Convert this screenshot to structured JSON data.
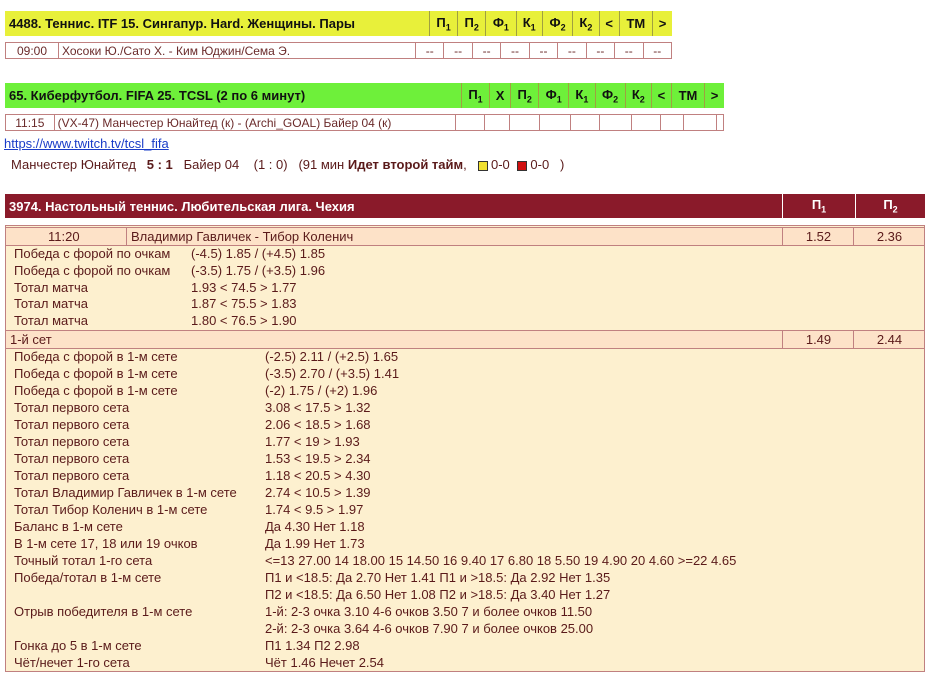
{
  "tennis": {
    "header_title": "4488. Теннис. ITF 15. Сингапур. Hard. Женщины. Пары",
    "cols": [
      "П1",
      "П2",
      "Ф1",
      "К1",
      "Ф2",
      "К2",
      "<",
      "ТМ",
      ">"
    ],
    "match": {
      "time": "09:00",
      "teams": "Хосоки Ю./Сато Х. - Ким Юджин/Сема Э.",
      "cells": [
        "--",
        "--",
        "--",
        "--",
        "--",
        "--",
        "--",
        "--",
        "--"
      ]
    }
  },
  "cyber": {
    "header_title": "65. Киберфутбол. FIFA 25. TCSL (2 по 6 минут)",
    "cols": [
      "П1",
      "Х",
      "П2",
      "Ф1",
      "К1",
      "Ф2",
      "К2",
      "<",
      "ТМ",
      ">"
    ],
    "match": {
      "time": "11:15",
      "teams": "(VX-47) Манчестер Юнайтед (к) - (Archi_GOAL) Байер 04 (к)"
    },
    "link": "https://www.twitch.tv/tcsl_fifa",
    "score_line": {
      "home": "Манчестер Юнайтед",
      "score": "5 : 1",
      "away": "Байер 04",
      "half": "(1 : 0)",
      "minute": "(91 мин",
      "status": "Идет второй тайм",
      "yellow": "0-0",
      "red": "0-0",
      "close": ")"
    }
  },
  "tt": {
    "header_title": "3974. Настольный теннис. Любительская лига. Чехия",
    "cols": [
      "П1",
      "П2"
    ],
    "match": {
      "time": "11:20",
      "teams": "Владимир Гавличек - Тибор Коленич",
      "p1": "1.52",
      "p2": "2.36"
    },
    "main_rows": [
      {
        "label": "Победа с форой по очкам",
        "value": "(-4.5) 1.85 / (+4.5) 1.85"
      },
      {
        "label": "Победа с форой по очкам",
        "value": "(-3.5) 1.75 / (+3.5) 1.96"
      },
      {
        "label": "Тотал матча",
        "value": "1.93 < 74.5 > 1.77"
      },
      {
        "label": "Тотал матча",
        "value": "1.87 < 75.5 > 1.83"
      },
      {
        "label": "Тотал матча",
        "value": "1.80 < 76.5 > 1.90"
      }
    ],
    "set1": {
      "label": "1-й сет",
      "p1": "1.49",
      "p2": "2.44"
    },
    "set_rows": [
      {
        "label": "Победа с форой в 1-м сете",
        "value": "(-2.5) 2.11 / (+2.5) 1.65"
      },
      {
        "label": "Победа с форой в 1-м сете",
        "value": "(-3.5) 2.70 / (+3.5) 1.41"
      },
      {
        "label": "Победа с форой в 1-м сете",
        "value": "(-2) 1.75 / (+2) 1.96"
      },
      {
        "label": "Тотал первого сета",
        "value": "3.08 < 17.5 > 1.32"
      },
      {
        "label": "Тотал первого сета",
        "value": "2.06 < 18.5 > 1.68"
      },
      {
        "label": "Тотал первого сета",
        "value": "1.77 < 19 > 1.93"
      },
      {
        "label": "Тотал первого сета",
        "value": "1.53 < 19.5 > 2.34"
      },
      {
        "label": "Тотал первого сета",
        "value": "1.18 < 20.5 > 4.30"
      },
      {
        "label": "Тотал Владимир Гавличек в 1-м сете",
        "value": "2.74 < 10.5 > 1.39"
      },
      {
        "label": "Тотал Тибор Коленич в 1-м сете",
        "value": "1.74 < 9.5 > 1.97"
      },
      {
        "label": "Баланс в 1-м сете",
        "value": "Да 4.30   Нет 1.18"
      },
      {
        "label": "В 1-м сете 17, 18 или 19 очков",
        "value": "Да 1.99   Нет 1.73"
      },
      {
        "label": "Точный тотал 1-го сета",
        "value": "<=13 27.00 14 18.00 15 14.50 16 9.40 17 6.80 18 5.50 19 4.90 20 4.60 >=22 4.65"
      },
      {
        "label": "Победа/тотал в 1-м сете",
        "value": "П1 и <18.5: Да 2.70 Нет 1.41    П1 и >18.5: Да 2.92 Нет 1.35"
      },
      {
        "label": "",
        "value": "П2 и <18.5: Да 6.50 Нет 1.08    П2 и >18.5: Да 3.40 Нет 1.27"
      },
      {
        "label": "Отрыв победителя в 1-м сете",
        "value": "1-й: 2-3 очка 3.10 4-6 очков 3.50 7 и более очков 11.50"
      },
      {
        "label": "",
        "value": "2-й: 2-3 очка 3.64 4-6 очков 7.90 7 и более очков 25.00"
      },
      {
        "label": "Гонка до 5 в 1-м сете",
        "value": "П1 1.34   П2 2.98"
      },
      {
        "label": "Чёт/нечет 1-го сета",
        "value": "Чёт 1.46   Нечет 2.54"
      }
    ]
  },
  "colors": {
    "tennis_header": "#e8f03a",
    "cyber_header": "#6ef03a",
    "tt_header": "#8a1a2a",
    "block_bg": "#fdf0cf",
    "link": "#1a3cc8"
  }
}
